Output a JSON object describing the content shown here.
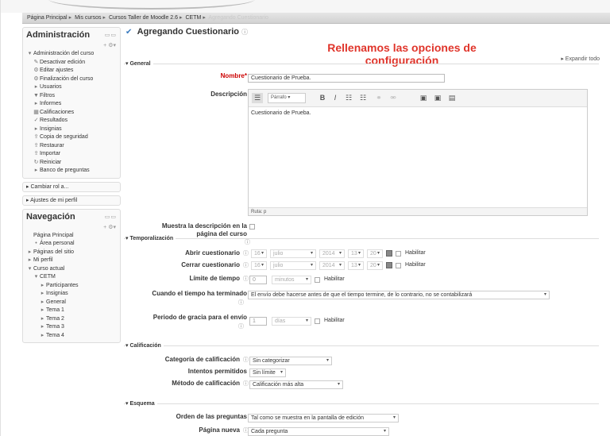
{
  "breadcrumb": [
    "Página Principal",
    "Mis cursos",
    "Cursos Taller de Moodle 2.6",
    "CETM",
    "Agregando Cuestionario"
  ],
  "admin_block": {
    "title": "Administración",
    "items": [
      {
        "icon": "▾",
        "label": "Administración del curso",
        "indent": 0
      },
      {
        "icon": "✎",
        "label": "Desactivar edición",
        "indent": 1
      },
      {
        "icon": "⚙",
        "label": "Editar ajustes",
        "indent": 1
      },
      {
        "icon": "⚙",
        "label": "Finalización del curso",
        "indent": 1
      },
      {
        "icon": "▸",
        "label": "Usuarios",
        "indent": 1
      },
      {
        "icon": "▼",
        "label": "Filtros",
        "indent": 1
      },
      {
        "icon": "▸",
        "label": "Informes",
        "indent": 1
      },
      {
        "icon": "▦",
        "label": "Calificaciones",
        "indent": 1
      },
      {
        "icon": "✓",
        "label": "Resultados",
        "indent": 1
      },
      {
        "icon": "▸",
        "label": "Insignias",
        "indent": 1
      },
      {
        "icon": "⇪",
        "label": "Copia de seguridad",
        "indent": 1
      },
      {
        "icon": "⇪",
        "label": "Restaurar",
        "indent": 1
      },
      {
        "icon": "⇪",
        "label": "Importar",
        "indent": 1
      },
      {
        "icon": "↻",
        "label": "Reiniciar",
        "indent": 1
      },
      {
        "icon": "▸",
        "label": "Banco de preguntas",
        "indent": 1
      }
    ],
    "extra": [
      "Cambiar rol a...",
      "Ajustes de mi perfil"
    ]
  },
  "nav_block": {
    "title": "Navegación",
    "items": [
      {
        "icon": "",
        "label": "Página Principal",
        "indent": 0
      },
      {
        "icon": "•",
        "label": "Área personal",
        "indent": 1
      },
      {
        "icon": "▸",
        "label": "Páginas del sitio",
        "indent": 0
      },
      {
        "icon": "▸",
        "label": "Mi perfil",
        "indent": 0
      },
      {
        "icon": "▾",
        "label": "Curso actual",
        "indent": 0
      },
      {
        "icon": "▾",
        "label": "CETM",
        "indent": 1
      },
      {
        "icon": "▸",
        "label": "Participantes",
        "indent": 2
      },
      {
        "icon": "▸",
        "label": "Insignias",
        "indent": 2
      },
      {
        "icon": "▸",
        "label": "General",
        "indent": 2
      },
      {
        "icon": "▸",
        "label": "Tema 1",
        "indent": 2
      },
      {
        "icon": "▸",
        "label": "Tema 2",
        "indent": 2
      },
      {
        "icon": "▸",
        "label": "Tema 3",
        "indent": 2
      },
      {
        "icon": "▸",
        "label": "Tema 4",
        "indent": 2
      }
    ]
  },
  "page": {
    "title": "Agregando Cuestionario",
    "annotation": "Rellenamos las opciones de configuración",
    "expand_all": "▸ Expandir todo"
  },
  "general": {
    "legend": "▾ General",
    "name_label": "Nombre*",
    "name_value": "Cuestionario de Prueba.",
    "desc_label": "Descripción",
    "editor_font": "Párrafo",
    "editor_text": "Cuestionario de Prueba.",
    "editor_path": "Ruta: p",
    "show_desc_label_1": "Muestra la descripción en la",
    "show_desc_label_2": "página del curso"
  },
  "timing": {
    "legend": "▾ Temporalización",
    "open_label": "Abrir cuestionario",
    "close_label": "Cerrar cuestionario",
    "day": "16",
    "month": "julio",
    "year": "2014",
    "hour": "13",
    "minute": "20",
    "enable": "Habilitar",
    "limit_label": "Límite de tiempo",
    "limit_value": "0",
    "limit_unit": "minutos",
    "expire_label": "Cuando el tiempo ha terminado",
    "expire_value": "El envío debe hacerse antes de que el tiempo termine, de lo contrario, no se contabilizará",
    "grace_label": "Periodo de gracia para el envío",
    "grace_value": "1",
    "grace_unit": "días"
  },
  "grading": {
    "legend": "▾ Calificación",
    "category_label": "Categoría de calificación",
    "category_value": "Sin categorizar",
    "attempts_label": "Intentos permitidos",
    "attempts_value": "Sin límite",
    "method_label": "Método de calificación",
    "method_value": "Calificación más alta"
  },
  "layout": {
    "legend": "▾ Esquema",
    "order_label": "Orden de las preguntas",
    "order_value": "Tal como se muestra en la pantalla de edición",
    "newpage_label": "Página nueva",
    "newpage_value": "Cada pregunta"
  },
  "colors": {
    "annotation": "#e0352b",
    "required": "#cc0000"
  }
}
